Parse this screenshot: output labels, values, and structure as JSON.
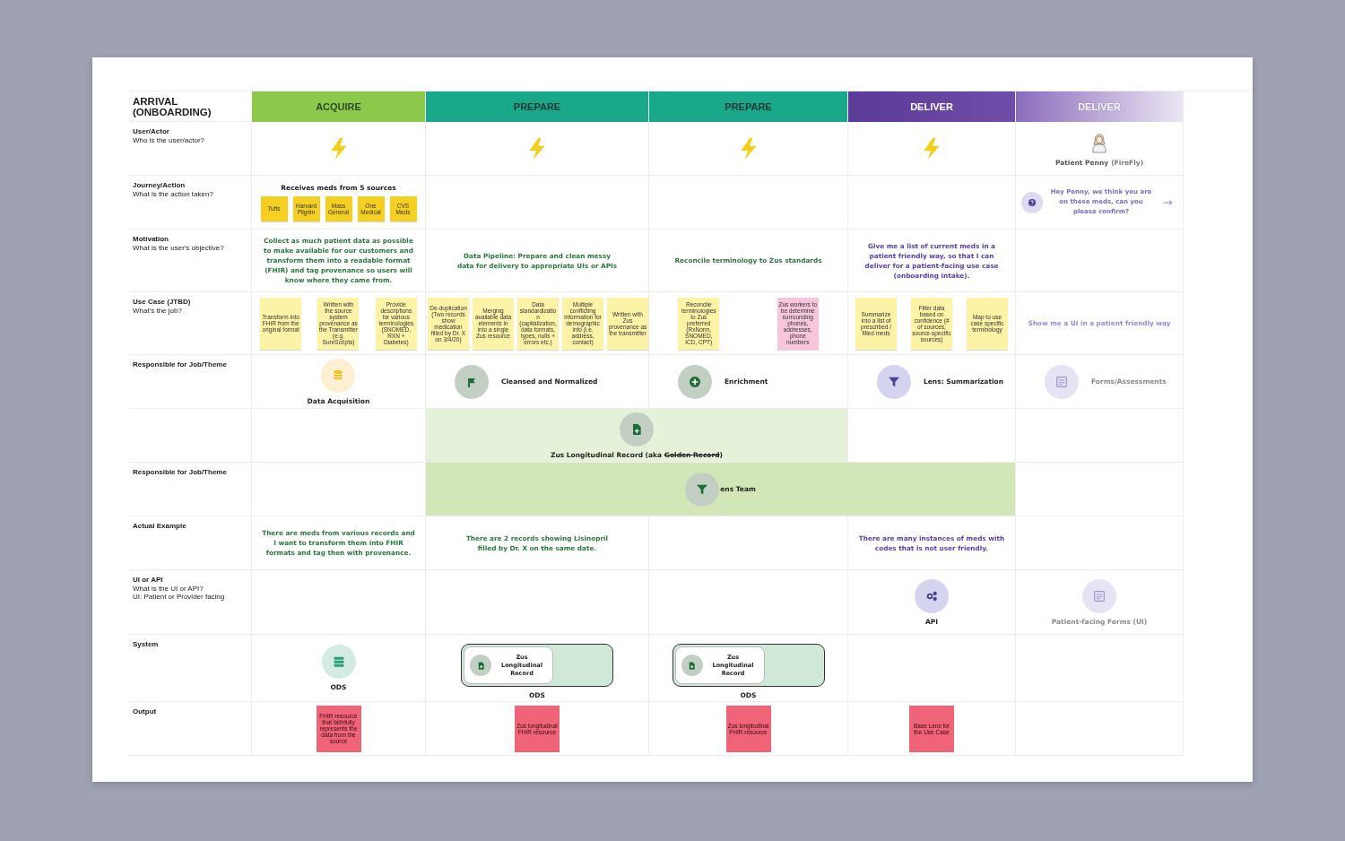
{
  "board": {
    "title": "ARRIVAL (ONBOARDING)"
  },
  "stages": [
    {
      "label": "ACQUIRE",
      "kind": "acquire",
      "faded": false
    },
    {
      "label": "PREPARE",
      "kind": "prepare",
      "faded": false
    },
    {
      "label": "PREPARE",
      "kind": "prepare",
      "faded": false
    },
    {
      "label": "DELIVER",
      "kind": "deliver",
      "faded": false
    },
    {
      "label": "DELIVER",
      "kind": "deliver",
      "faded": true
    }
  ],
  "rows": [
    {
      "title": "User/Actor",
      "question": "Who is the user/actor?",
      "cells": [
        {
          "kind": "bolt"
        },
        {
          "kind": "bolt"
        },
        {
          "kind": "bolt"
        },
        {
          "kind": "bolt"
        },
        {
          "kind": "actor",
          "name": "Patient Penny",
          "tag": "(FireFly)"
        }
      ]
    },
    {
      "title": "Journey/Action",
      "question": "What is the action taken?",
      "cells": [
        {
          "kind": "sources",
          "title": "Receives meds from 5 sources",
          "notes": [
            {
              "text": "Tufts",
              "color": "#f5d020"
            },
            {
              "text": "Harvard Pilgrim",
              "color": "#f5d020"
            },
            {
              "text": "Mass General",
              "color": "#f5d020"
            },
            {
              "text": "One Medical",
              "color": "#f5d020"
            },
            {
              "text": "CVS Meds",
              "color": "#f5d020"
            }
          ]
        },
        {
          "kind": "empty"
        },
        {
          "kind": "empty"
        },
        {
          "kind": "empty"
        },
        {
          "kind": "message",
          "text": "Hey Penny, we think you are on these meds, can you please confirm?"
        }
      ]
    },
    {
      "title": "Motivation",
      "question": "What is the user's objective?",
      "cells": [
        {
          "kind": "text",
          "color": "#2b7a3b",
          "text": "Collect as much patient data as possible to make available for our customers and transform them into a readable format (FHIR) and tag provenance so users will know where they came from."
        },
        {
          "kind": "text",
          "color": "#2b7a3b",
          "text": "Data Pipeline: Prepare and clean messy data for delivery to appropriate UIs or APIs"
        },
        {
          "kind": "text",
          "color": "#2b7a3b",
          "text": "Reconcile terminology to Zus standards"
        },
        {
          "kind": "text",
          "color": "#5a3fa8",
          "text": "Give me a list of current meds in a patient friendly way, so that I can deliver for a patient-facing use case (onboarding intake)."
        },
        {
          "kind": "empty"
        }
      ]
    },
    {
      "title": "Use Case (JTBD)",
      "question": "What's the job?",
      "cells": [
        {
          "kind": "stickies",
          "notes": [
            {
              "text": "Transform into FHIR from the original format",
              "color": "#fdf3a7"
            },
            {
              "text": "Written with the source system provenance as the Transmitter (e.g. SureScripts)",
              "color": "#fdf3a7"
            },
            {
              "text": "Provide descriptions for various terminologies (SNOMED, RXN + Diabetes)",
              "color": "#fdf3a7"
            }
          ]
        },
        {
          "kind": "stickies",
          "notes": [
            {
              "text": "De-duplication (Two records show medication filled by Dr. X on 3/4/20)",
              "color": "#fdf3a7"
            },
            {
              "text": "Merging available data elements in into a single Zus resource",
              "color": "#fdf3a7"
            },
            {
              "text": "Data standardization (capitalization, data formats, types, nulls + errors etc.)",
              "color": "#fdf3a7"
            },
            {
              "text": "Multiple conflicting information for demographic info (i.e. address, contact)",
              "color": "#fdf3a7"
            },
            {
              "text": "Written with Zus provenance as the transmitter",
              "color": "#fdf3a7"
            }
          ]
        },
        {
          "kind": "stickies",
          "notes": [
            {
              "text": "Reconcile terminologies to Zus preferred (RxNorm, SNOMED, ICD, CPT)",
              "color": "#fdf3a7"
            },
            {
              "text": "Zus workers to be determine surrounding phones, addresses, phone numbers",
              "color": "#f7c6dc"
            }
          ]
        },
        {
          "kind": "stickies",
          "notes": [
            {
              "text": "Summarize into a list of prescribed / filled meds",
              "color": "#fdf3a7"
            },
            {
              "text": "Filter data based on confidence (# of sources, source-specific sources)",
              "color": "#fdf3a7"
            },
            {
              "text": "Map to use case specific terminology",
              "color": "#fdf3a7"
            }
          ]
        },
        {
          "kind": "text",
          "color": "#9a8ad6",
          "text": "Show me a UI in a patient friendly way"
        }
      ]
    },
    {
      "title": "Responsible for Job/Theme",
      "cells": [
        {
          "kind": "stacked",
          "label": "Data Acquisition",
          "color": "#222222",
          "badge": {
            "color": "#fdefd2"
          },
          "icon": {
            "kind": "database",
            "color": "#f0be1a"
          }
        },
        {
          "kind": "inline",
          "label": "Cleansed and Normalized",
          "color": "#222222",
          "badge": {
            "color": "#c4cfc3"
          },
          "icon": {
            "kind": "flag",
            "color": "#1c6b38"
          }
        },
        {
          "kind": "inline",
          "label": "Enrichment",
          "color": "#222222",
          "badge": {
            "color": "#c4cfc3"
          },
          "icon": {
            "kind": "plus",
            "color": "#1c6b38"
          }
        },
        {
          "kind": "inline",
          "label": "Lens: Summarization",
          "color": "#222222",
          "badge": {
            "color": "#d5d4ee"
          },
          "icon": {
            "kind": "filter",
            "color": "#4a3f9c"
          }
        },
        {
          "kind": "inline",
          "label": "Forms/Assessments",
          "color": "#8a8a8a",
          "badge": {
            "color": "#e6e4f4"
          },
          "icon": {
            "kind": "form",
            "color": "#9d97d0"
          }
        }
      ]
    },
    {
      "cells": [
        {
          "kind": "empty"
        },
        {
          "kind": "band",
          "color": "#e6f1d9",
          "content": {
            "kind": "stacked",
            "label": "Zus Longitudinal Record (aka ",
            "struck": "Golden Record",
            "after": ")",
            "color": "#222222",
            "badge": {
              "color": "#c4cfc3"
            },
            "icon": {
              "kind": "file",
              "color": "#1c6b38"
            }
          }
        },
        {
          "kind": "empty"
        },
        {
          "kind": "empty"
        }
      ]
    },
    {
      "title": "Responsible for Job/Theme",
      "cells": [
        {
          "kind": "empty"
        },
        {
          "kind": "band",
          "color": "#d2e6b8",
          "content": {
            "kind": "inline",
            "label": "ens Team",
            "color": "#222222",
            "badge": {
              "color": "#c4cfc3"
            },
            "icon": {
              "kind": "filter",
              "color": "#1c6b38"
            }
          }
        },
        {
          "kind": "empty"
        }
      ]
    },
    {
      "title": "Actual Example",
      "cells": [
        {
          "kind": "text",
          "color": "#2b7a3b",
          "text": "There are meds from various records and I want to transform them into FHIR formats and tag then with provenance."
        },
        {
          "kind": "text",
          "color": "#2b7a3b",
          "text": "There are 2 records showing Lisinopril filled by Dr. X on the same date."
        },
        {
          "kind": "empty"
        },
        {
          "kind": "text",
          "color": "#5a3fa8",
          "text": "There are many instances of meds with codes that is not user friendly."
        },
        {
          "kind": "empty"
        }
      ]
    },
    {
      "title": "UI or API",
      "question": "What is the UI or API?",
      "note": "UI: Patient or Provider facing",
      "cells": [
        {
          "kind": "empty"
        },
        {
          "kind": "empty"
        },
        {
          "kind": "empty"
        },
        {
          "kind": "stacked",
          "label": "API",
          "color": "#222222",
          "badge": {
            "color": "#d5d4ee"
          },
          "icon": {
            "kind": "gears",
            "color": "#4a3f9c"
          }
        },
        {
          "kind": "stacked",
          "label": "Patient-facing Forms (UI)",
          "color": "#8a8a8a",
          "badge": {
            "color": "#e6e4f4"
          },
          "icon": {
            "kind": "form",
            "color": "#9d97d0"
          }
        }
      ]
    },
    {
      "title": "System",
      "cells": [
        {
          "kind": "stacked",
          "label": "ODS",
          "color": "#222222",
          "badge": {
            "color": "#d3ebe2"
          },
          "icon": {
            "kind": "server",
            "color": "#2a9d7a"
          }
        },
        {
          "kind": "system",
          "record": "Zus Longitudinal Record",
          "label": "ODS"
        },
        {
          "kind": "system",
          "record": "Zus Longitudinal Record",
          "label": "ODS"
        },
        {
          "kind": "empty"
        },
        {
          "kind": "empty"
        }
      ]
    },
    {
      "title": "Output",
      "cells": [
        {
          "kind": "stickies",
          "notes": [
            {
              "text": "FHIR resource that faithfully represents the data from the source",
              "color": "#f06478"
            }
          ]
        },
        {
          "kind": "stickies",
          "notes": [
            {
              "text": "Zus longitudinal FHIR resource",
              "color": "#f06478"
            }
          ]
        },
        {
          "kind": "stickies",
          "notes": [
            {
              "text": "Zus longitudinal FHIR resource",
              "color": "#f06478"
            }
          ]
        },
        {
          "kind": "stickies",
          "notes": [
            {
              "text": "Base Lens for the Use Case",
              "color": "#f06478"
            }
          ]
        },
        {
          "kind": "empty"
        }
      ]
    }
  ]
}
